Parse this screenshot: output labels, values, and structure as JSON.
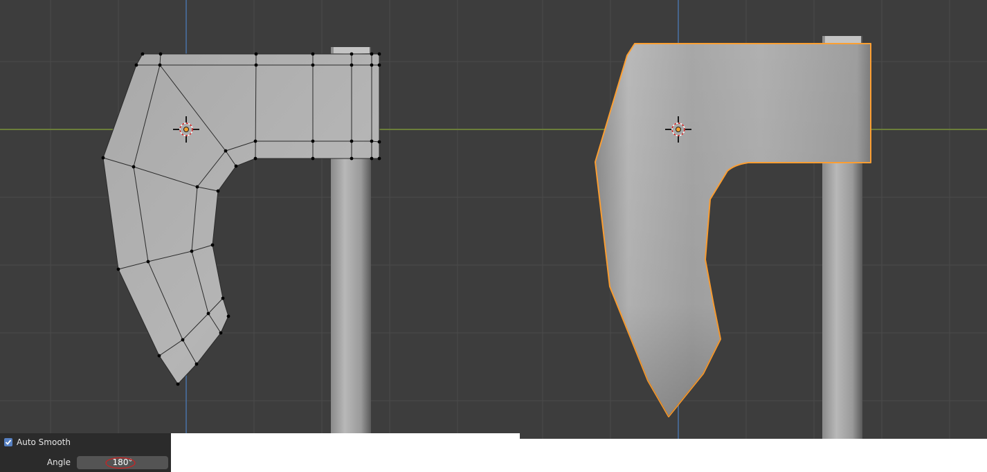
{
  "colors": {
    "viewport_background": "#3d3d3d",
    "grid_line": "#4a4a4a",
    "x_axis": "#6c7f3a",
    "y_axis": "#4a73a8",
    "selection_outline": "#ffa032",
    "panel_background": "#2b2b2b",
    "checkbox_accent": "#5680c2",
    "annotation_red": "#d02020"
  },
  "left_viewport": {
    "mode": "edit-mode-wireframe"
  },
  "right_viewport": {
    "mode": "object-mode-smooth-shaded"
  },
  "operator_panel": {
    "auto_smooth": {
      "label": "Auto Smooth",
      "checked": true
    },
    "angle": {
      "label": "Angle",
      "value": "180°"
    }
  },
  "icons": [
    "3d-cursor-icon",
    "checkbox-check-icon",
    "origin-dot-icon"
  ]
}
